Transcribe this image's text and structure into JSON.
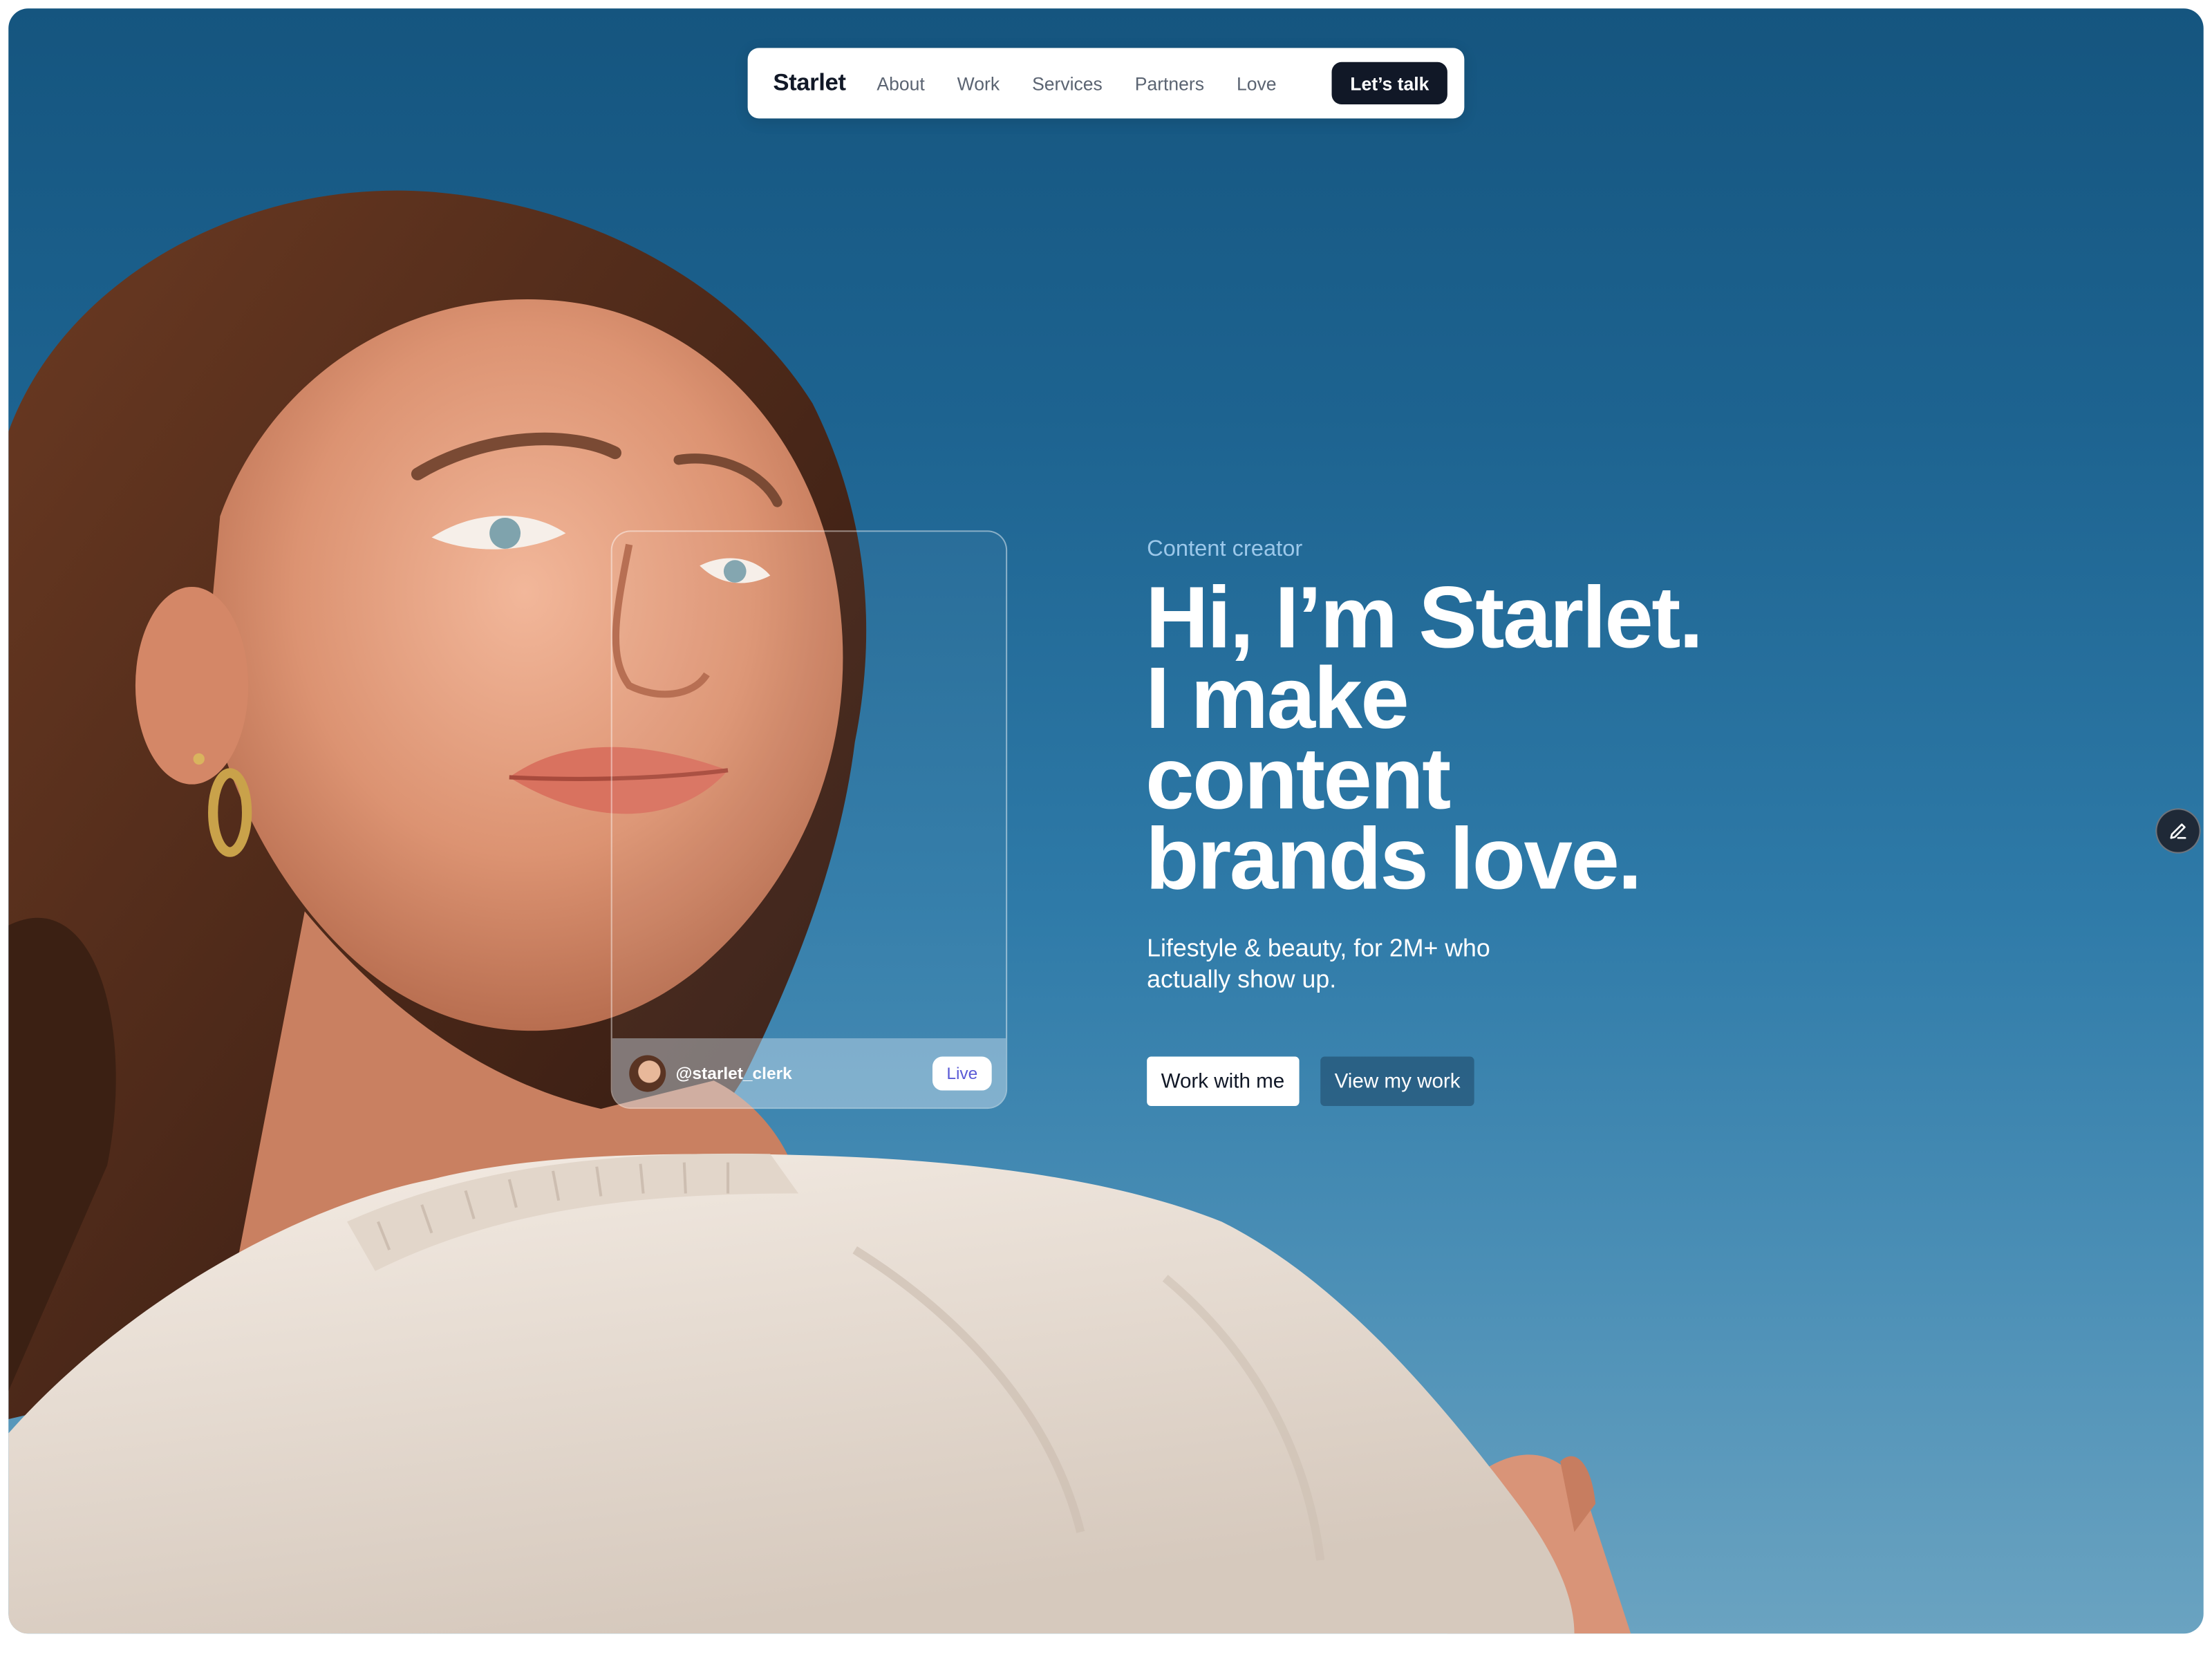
{
  "nav": {
    "brand": "Starlet",
    "links": [
      "About",
      "Work",
      "Services",
      "Partners",
      "Love"
    ],
    "cta": "Let’s talk"
  },
  "profile_card": {
    "handle": "@starlet_clerk",
    "badge": "Live"
  },
  "hero": {
    "eyebrow": "Content creator",
    "headline": [
      "Hi, I’m Starlet.",
      "I make",
      "content",
      "brands love."
    ],
    "subtitle": "Lifestyle & beauty, for 2M+ who actually show up.",
    "primary_button": "Work with me",
    "secondary_button": "View my work"
  },
  "icons": {
    "edit": "pencil-icon",
    "avatar": "avatar-image"
  },
  "colors": {
    "sky_top": "#15557f",
    "sky_bottom": "#6aa3c1",
    "nav_cta_bg": "#111827",
    "eyebrow": "#9cc8ea",
    "live_badge_text": "#5b5bd6"
  }
}
